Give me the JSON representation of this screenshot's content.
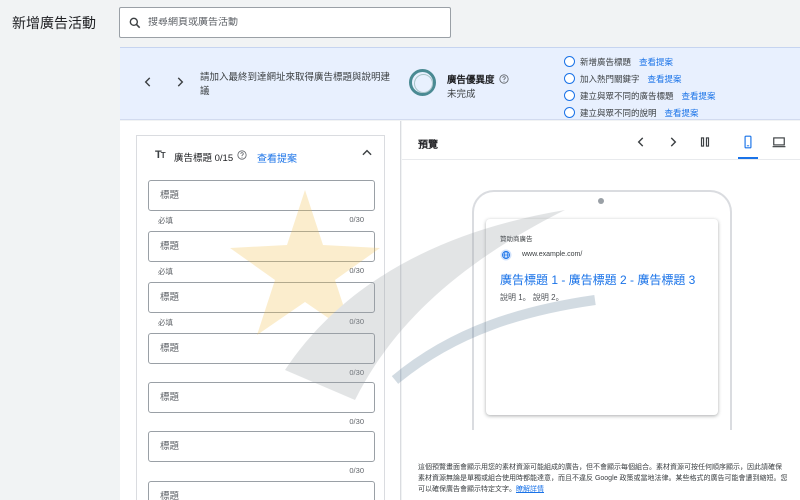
{
  "header": {
    "title": "新增廣告活動",
    "search_placeholder": "搜尋網頁或廣告活動"
  },
  "banner": {
    "message": "請加入最終到達網址來取得廣告標題與說明建議",
    "strength_title": "廣告優異度",
    "strength_status": "未完成",
    "suggestions": [
      {
        "label": "新增廣告標題",
        "link": "查看提案"
      },
      {
        "label": "加入熱門關鍵字",
        "link": "查看提案"
      },
      {
        "label": "建立與眾不同的廣告標題",
        "link": "查看提案"
      },
      {
        "label": "建立與眾不同的說明",
        "link": "查看提案"
      }
    ]
  },
  "headlines": {
    "title": "廣告標題 0/15",
    "link": "查看提案",
    "fields": [
      {
        "placeholder": "標題",
        "required": "必填",
        "count": "0/30"
      },
      {
        "placeholder": "標題",
        "required": "必填",
        "count": "0/30"
      },
      {
        "placeholder": "標題",
        "required": "必填",
        "count": "0/30"
      },
      {
        "placeholder": "標題",
        "required": "",
        "count": "0/30"
      },
      {
        "placeholder": "標題",
        "required": "",
        "count": "0/30"
      },
      {
        "placeholder": "標題",
        "required": "",
        "count": "0/30"
      },
      {
        "placeholder": "標題",
        "required": "",
        "count": ""
      }
    ]
  },
  "preview": {
    "title": "預覽",
    "ad_label": "贊助商廣告",
    "url": "www.example.com/",
    "headline": "廣告標題 1 - 廣告標題 2 - 廣告標題 3",
    "description": "說明 1。 說明 2。",
    "disclaimer": "這個預覽畫面會顯示用您的素材資源可能組成的廣告，但不會顯示每個組合。素材資源可按任何順序顯示，因此請確保素材資源無論是單獨或組合使用時都能達意，而且不違反 Google 政策或當地法律。某些格式的廣告可能會遭到縮短。您可以確保廣告會顯示特定文字。",
    "disclaimer_link": "瞭解詳情"
  },
  "colors": {
    "accent": "#1a73e8",
    "banner_bg": "#e8f0fe",
    "ring": "#4a8a93"
  }
}
